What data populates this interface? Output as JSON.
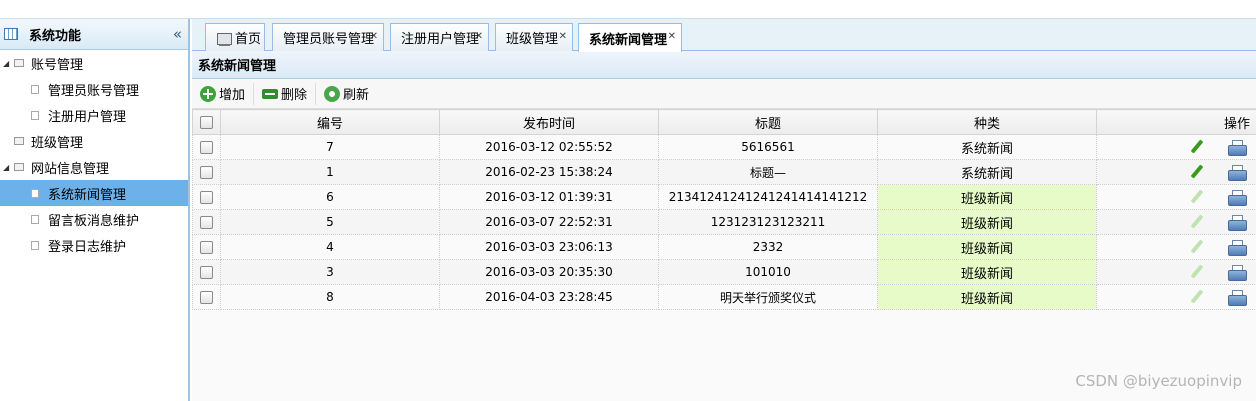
{
  "sidebar": {
    "title": "系统功能",
    "collapse_icon": "«",
    "tree": [
      {
        "label": "账号管理",
        "level": 1,
        "expanded": true
      },
      {
        "label": "管理员账号管理",
        "level": 2
      },
      {
        "label": "注册用户管理",
        "level": 2
      },
      {
        "label": "班级管理",
        "level": 1,
        "expanded": false
      },
      {
        "label": "网站信息管理",
        "level": 1,
        "expanded": true
      },
      {
        "label": "系统新闻管理",
        "level": 2,
        "selected": true
      },
      {
        "label": "留言板消息维护",
        "level": 2
      },
      {
        "label": "登录日志维护",
        "level": 2
      }
    ]
  },
  "tabs": [
    {
      "label": "首页",
      "closable": false
    },
    {
      "label": "管理员账号管理",
      "closable": true
    },
    {
      "label": "注册用户管理",
      "closable": true
    },
    {
      "label": "班级管理",
      "closable": true
    },
    {
      "label": "系统新闻管理",
      "closable": true,
      "active": true
    }
  ],
  "panel": {
    "title": "系统新闻管理"
  },
  "toolbar": {
    "add": "增加",
    "delete": "删除",
    "refresh": "刷新"
  },
  "grid": {
    "columns": [
      "编号",
      "发布时间",
      "标题",
      "种类",
      "操作"
    ],
    "rows": [
      {
        "id": "7",
        "time": "2016-03-12 02:55:52",
        "title": "5616561",
        "type": "系统新闻",
        "editable": true
      },
      {
        "id": "1",
        "time": "2016-02-23 15:38:24",
        "title": "标题—",
        "type": "系统新闻",
        "editable": true
      },
      {
        "id": "6",
        "time": "2016-03-12 01:39:31",
        "title": "21341241241241241414141212",
        "type": "班级新闻",
        "editable": false
      },
      {
        "id": "5",
        "time": "2016-03-07 22:52:31",
        "title": "123123123123211",
        "type": "班级新闻",
        "editable": false
      },
      {
        "id": "4",
        "time": "2016-03-03 23:06:13",
        "title": "2332",
        "type": "班级新闻",
        "editable": false
      },
      {
        "id": "3",
        "time": "2016-03-03 20:35:30",
        "title": "101010",
        "type": "班级新闻",
        "editable": false
      },
      {
        "id": "8",
        "time": "2016-04-03 23:28:45",
        "title": "明天举行颁奖仪式",
        "type": "班级新闻",
        "editable": false
      }
    ]
  },
  "watermark": "CSDN @biyezuopinvip",
  "icons": {
    "edit": "pencil-icon",
    "print": "printer-icon",
    "collapse": "double-chevron-left-icon"
  }
}
